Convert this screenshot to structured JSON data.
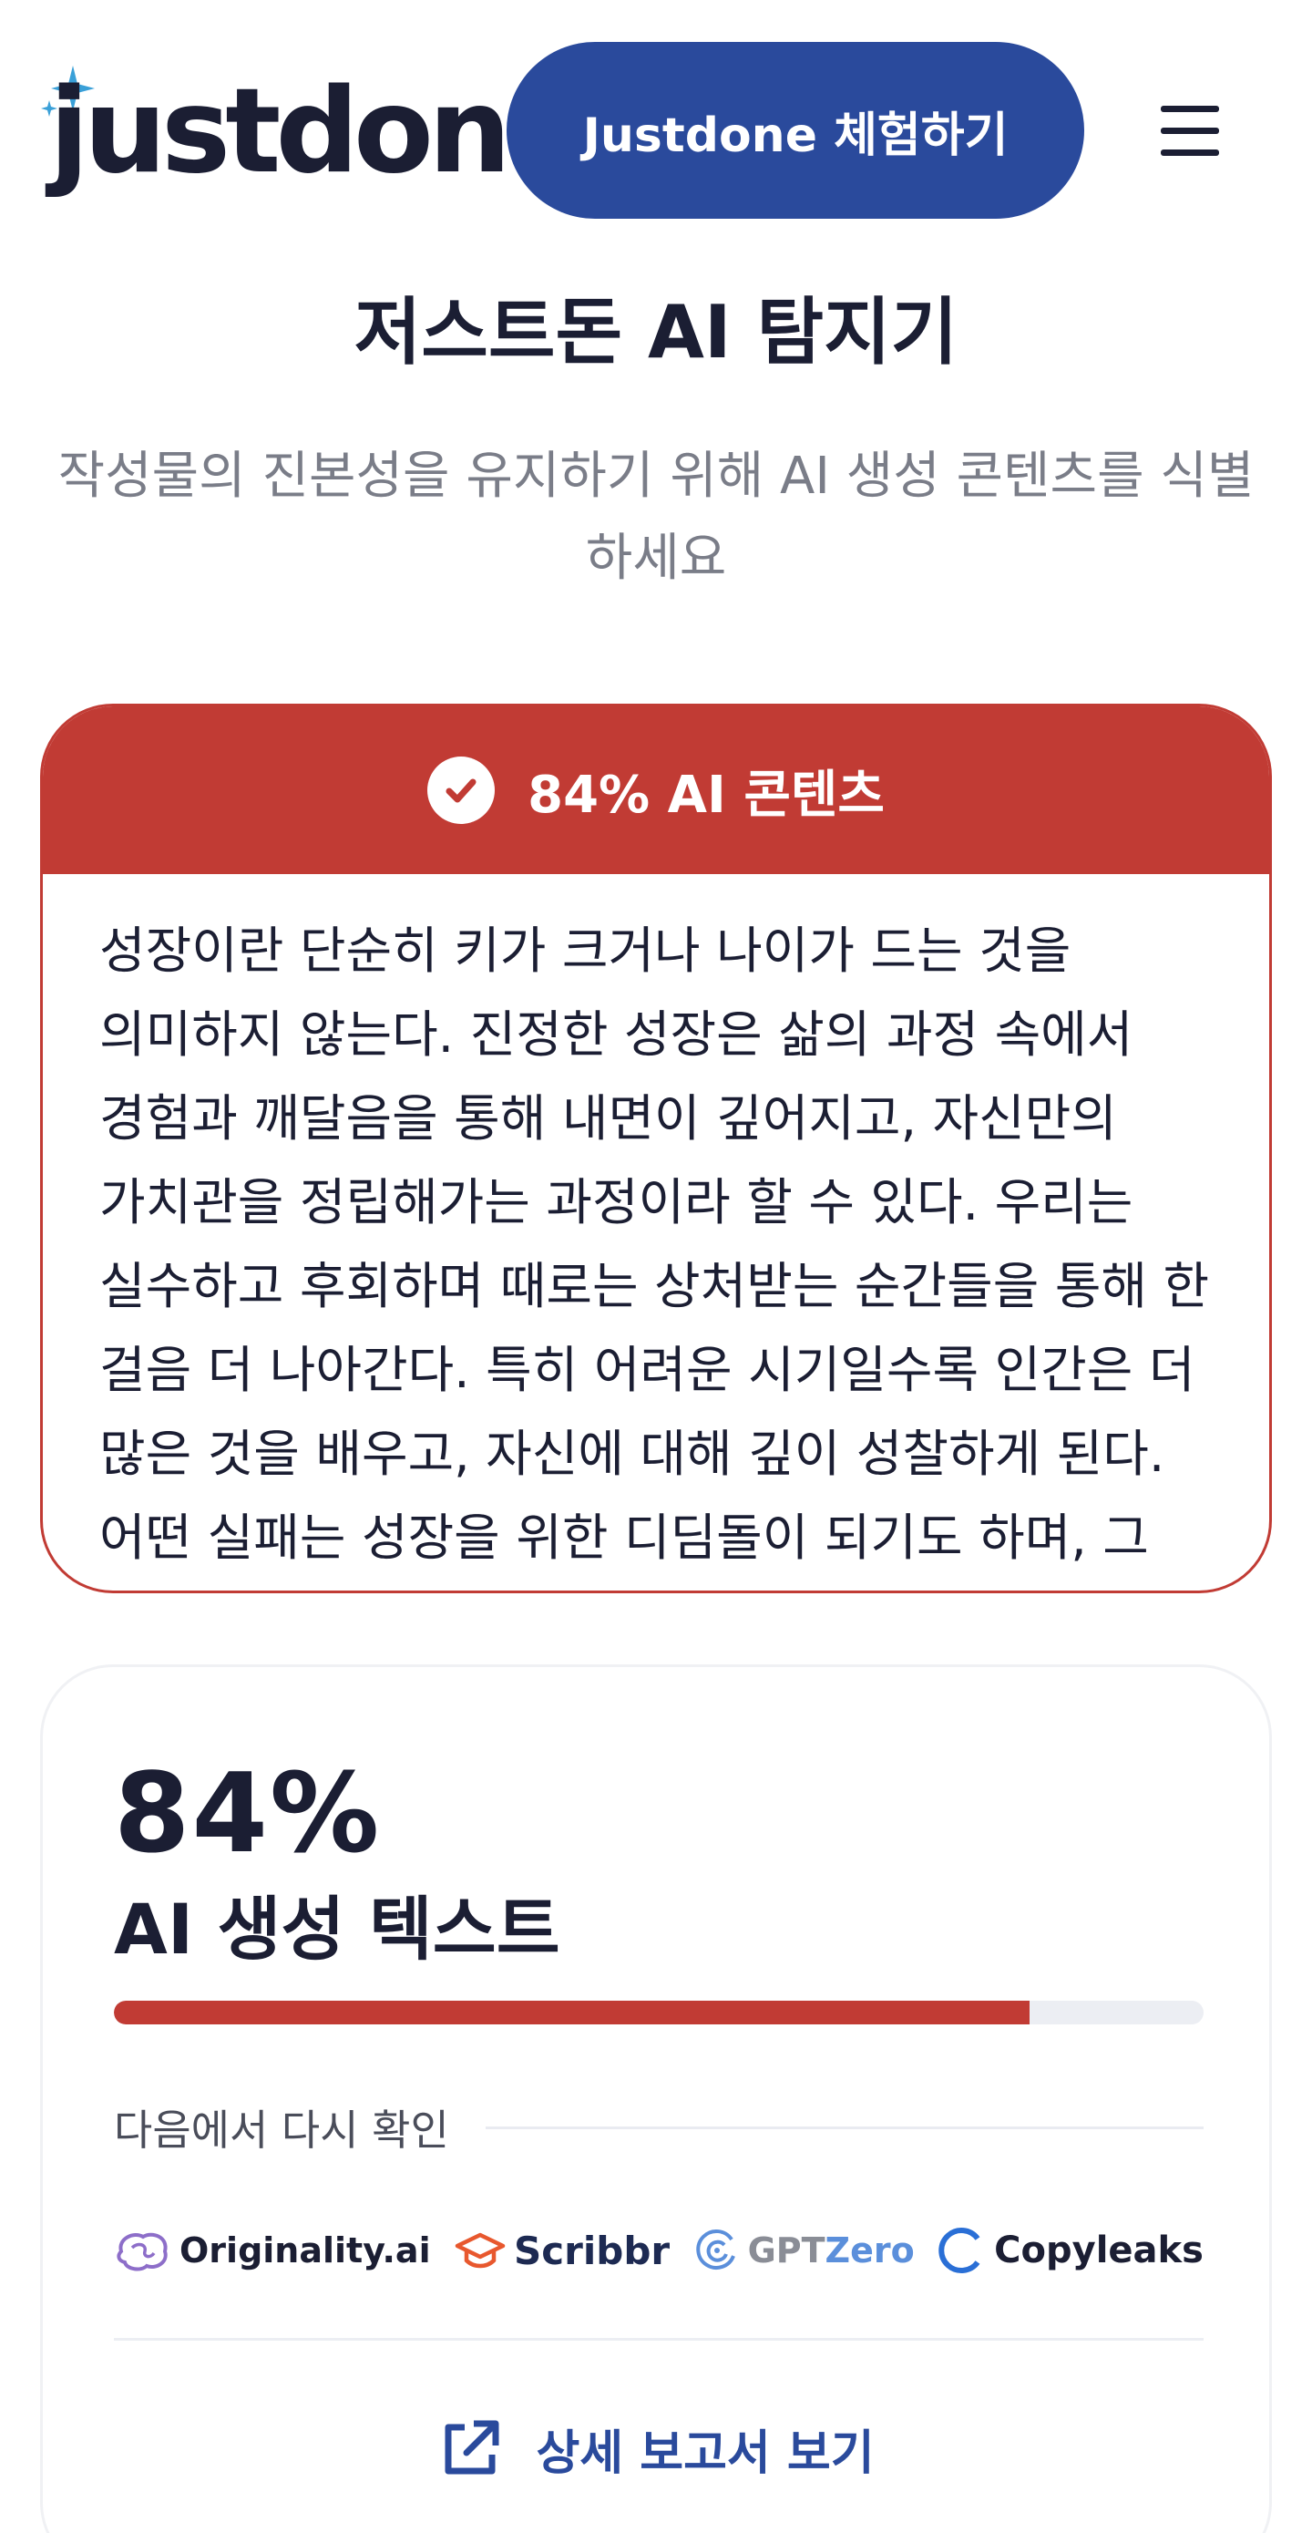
{
  "header": {
    "logo_text": "justdone",
    "cta_label": "Justdone 체험하기"
  },
  "page": {
    "title": "저스트돈 AI 탐지기",
    "subtitle": "작성물의 진본성을 유지하기 위해 AI 생성 콘텐츠를 식별하세요"
  },
  "result": {
    "title": "84% AI 콘텐츠",
    "body": "성장이란 단순히 키가 크거나 나이가 드는 것을 의미하지 않는다. 진정한 성장은 삶의 과정 속에서 경험과 깨달음을 통해 내면이 깊어지고, 자신만의 가치관을 정립해가는 과정이라 할 수 있다. 우리는 실수하고 후회하며 때로는 상처받는 순간들을 통해 한 걸음 더 나아간다. 특히 어려운 시기일수록 인간은 더 많은 것을 배우고, 자신에 대해 깊이 성찰하게 된다. 어떤 실패는 성장을 위한 디딤돌이 되기도 하며, 그 경험을 바탕으로 더 단단해진다."
  },
  "stats": {
    "percent": "84%",
    "percent_value": 0.84,
    "label": "AI 생성 텍스트",
    "recheck_label": "다음에서 다시 확인",
    "partners": [
      {
        "name": "Originality.ai"
      },
      {
        "name": "Scribbr"
      },
      {
        "name_prefix": "GPT",
        "name_suffix": "Zero"
      },
      {
        "name": "Copyleaks"
      }
    ],
    "report_link_label": "상세 보고서 보기"
  },
  "colors": {
    "brand_blue": "#2a4a9c",
    "alert_red": "#c13b34",
    "sparkle_blue": "#3aa0d8"
  }
}
